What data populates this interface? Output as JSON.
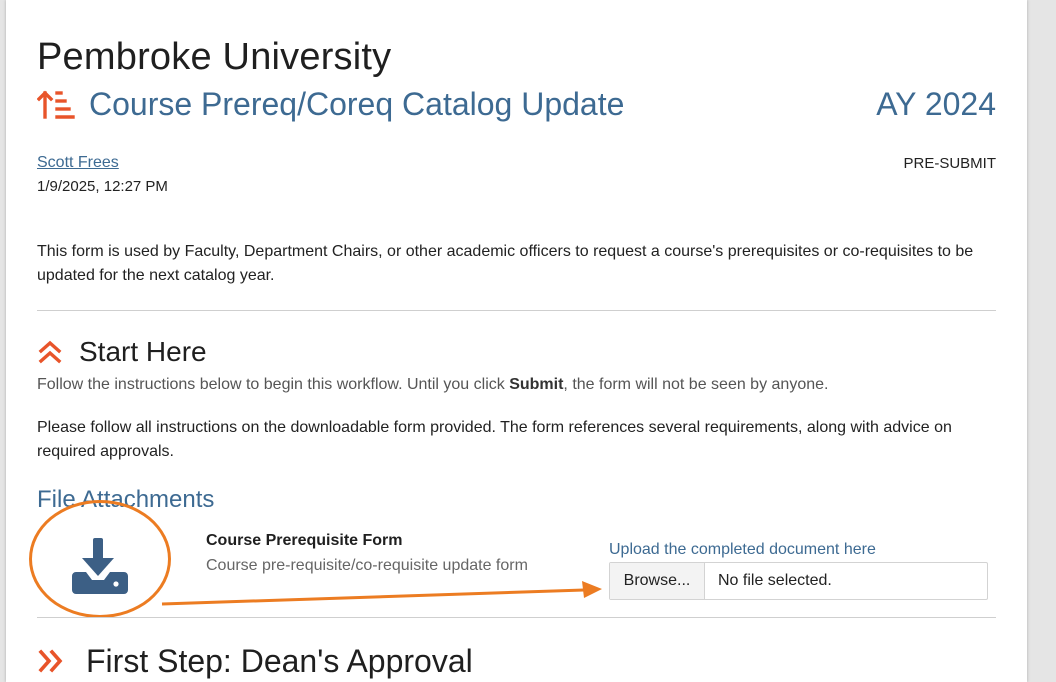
{
  "header": {
    "university": "Pembroke University",
    "form_title": "Course Prereq/Coreq Catalog Update",
    "academic_year": "AY 2024",
    "user_name": "Scott Frees",
    "timestamp": "1/9/2025, 12:27 PM",
    "status": "PRE-SUBMIT"
  },
  "description": "This form is used by Faculty, Department Chairs, or other academic officers to request a course's prerequisites or co-requisites to be updated for the next catalog year.",
  "start_section": {
    "title": "Start Here",
    "instruction_prefix": "Follow the instructions below to begin this workflow. Until you click ",
    "instruction_bold": "Submit",
    "instruction_suffix": ", the form will not be seen by anyone.",
    "paragraph": "Please follow all instructions on the downloadable form provided. The form references several requirements, along with advice on required approvals."
  },
  "attachments": {
    "title": "File Attachments",
    "doc_name": "Course Prerequisite Form",
    "doc_desc": "Course pre-requisite/co-requisite update form",
    "upload_label": "Upload the completed document here",
    "browse_label": "Browse...",
    "file_status": "No file selected."
  },
  "next_section": {
    "title": "First Step: Dean's Approval"
  },
  "colors": {
    "accent_orange": "#e8542a",
    "annotation_orange": "#ec7c22",
    "link_blue": "#3d6a92",
    "icon_blue": "#3c5f85"
  },
  "icons": {
    "title_icon": "sort-ascending-icon",
    "start_icon": "chevron-double-up-icon",
    "download_icon": "download-icon",
    "next_icon": "chevron-double-right-icon"
  }
}
